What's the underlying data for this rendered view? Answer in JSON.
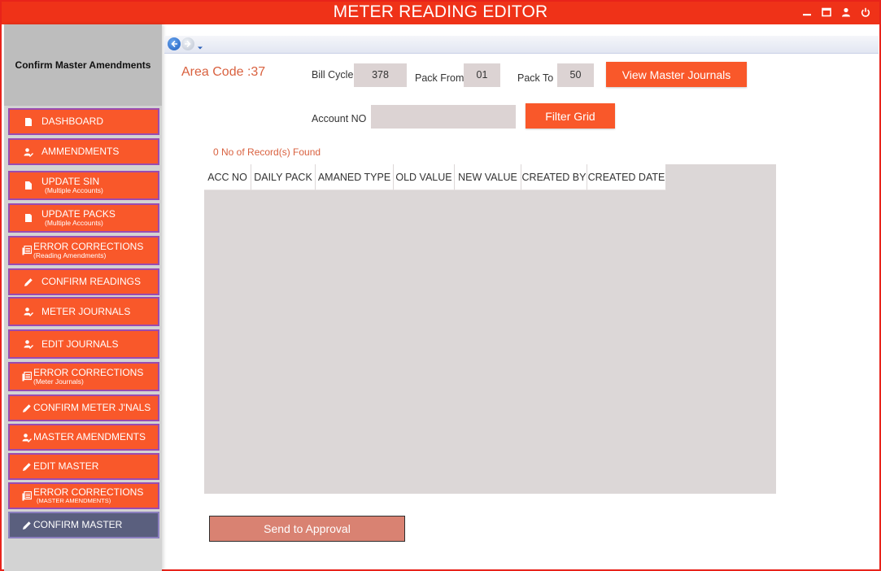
{
  "window": {
    "title": "METER READING EDITOR",
    "controls": [
      "minimize-icon",
      "maximize-icon",
      "user-icon",
      "power-icon"
    ]
  },
  "sidebar": {
    "header": "Confirm Master Amendments",
    "items": [
      {
        "label": "DASHBOARD",
        "sub": "",
        "icon": "document-icon"
      },
      {
        "label": "AMMENDMENTS",
        "sub": "",
        "icon": "user-edit-icon"
      },
      {
        "label": "UPDATE SIN",
        "sub": "(Multiple Accounts)",
        "icon": "file-icon"
      },
      {
        "label": "UPDATE PACKS",
        "sub": "(Multiple Accounts)",
        "icon": "document-icon"
      },
      {
        "label": "ERROR CORRECTIONS",
        "sub": "(Reading Amendments)",
        "icon": "list-icon"
      },
      {
        "label": "CONFIRM READINGS",
        "sub": "",
        "icon": "pencil-icon"
      },
      {
        "label": "METER JOURNALS",
        "sub": "",
        "icon": "user-edit-icon"
      },
      {
        "label": "EDIT JOURNALS",
        "sub": "",
        "icon": "user-edit-icon"
      },
      {
        "label": "ERROR CORRECTIONS",
        "sub": "(Meter Journals)",
        "icon": "list-icon"
      },
      {
        "label": "CONFIRM METER J'NALS",
        "sub": "",
        "icon": "pencil-icon"
      },
      {
        "label": "MASTER AMENDMENTS",
        "sub": "",
        "icon": "user-edit-icon"
      },
      {
        "label": "EDIT MASTER",
        "sub": "",
        "icon": "pencil-icon"
      },
      {
        "label": "ERROR CORRECTIONS",
        "sub": "(MASTER AMENDMENTS)",
        "icon": "list-icon"
      },
      {
        "label": "CONFIRM MASTER",
        "sub": "",
        "icon": "pencil-icon",
        "active": true
      }
    ]
  },
  "form": {
    "area_code": "Area Code :37",
    "bill_cycle_label": "Bill Cycle",
    "bill_cycle_value": "378",
    "pack_from_label": "Pack From",
    "pack_from_value": "01",
    "pack_to_label": "Pack To",
    "pack_to_value": "50",
    "view_button": "View Master Journals",
    "account_label": "Account NO",
    "account_value": "",
    "filter_button": "Filter Grid"
  },
  "grid": {
    "records_text": "0 No of Record(s) Found",
    "columns": [
      "ACC NO",
      "DAILY PACK",
      "AMANED TYPE",
      "OLD VALUE",
      "NEW VALUE",
      "CREATED BY",
      "CREATED DATE"
    ],
    "rows": []
  },
  "actions": {
    "send_button": "Send to Approval"
  },
  "colors": {
    "title_bar": "#ef3218",
    "nav_button": "#f9582a",
    "nav_active": "#5a5f7e",
    "accent_text": "#d9613f"
  }
}
